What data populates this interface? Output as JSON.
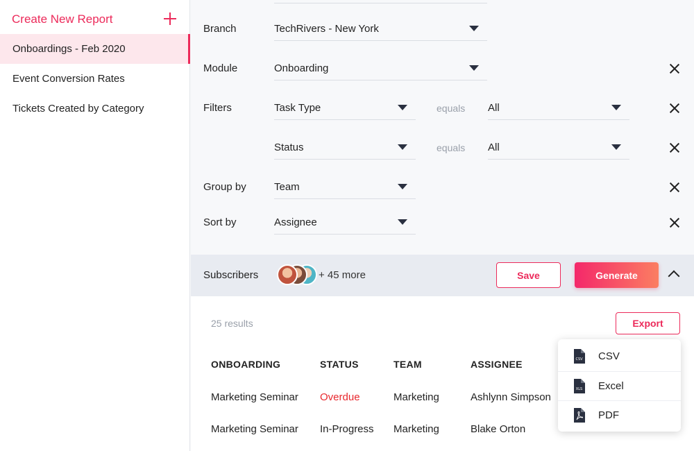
{
  "sidebar": {
    "create_label": "Create New Report",
    "items": [
      {
        "label": "Onboardings - Feb 2020",
        "active": true
      },
      {
        "label": "Event Conversion Rates",
        "active": false
      },
      {
        "label": "Tickets Created by Category",
        "active": false
      }
    ]
  },
  "form": {
    "branch": {
      "label": "Branch",
      "value": "TechRivers - New York"
    },
    "module": {
      "label": "Module",
      "value": "Onboarding"
    },
    "filters": {
      "label": "Filters",
      "rows": [
        {
          "field": "Task Type",
          "operator": "equals",
          "value": "All"
        },
        {
          "field": "Status",
          "operator": "equals",
          "value": "All"
        }
      ]
    },
    "group_by": {
      "label": "Group by",
      "value": "Team"
    },
    "sort_by": {
      "label": "Sort by",
      "value": "Assignee"
    }
  },
  "subscribers": {
    "label": "Subscribers",
    "more": "+ 45 more",
    "save_label": "Save",
    "generate_label": "Generate"
  },
  "results": {
    "count_text": "25 results",
    "export_label": "Export",
    "columns": [
      "ONBOARDING",
      "STATUS",
      "TEAM",
      "ASSIGNEE"
    ],
    "rows": [
      {
        "onboarding": "Marketing Seminar",
        "status": "Overdue",
        "team": "Marketing",
        "assignee": "Ashlynn Simpson"
      },
      {
        "onboarding": "Marketing Seminar",
        "status": "In-Progress",
        "team": "Marketing",
        "assignee": "Blake Orton"
      }
    ],
    "status_colors": {
      "Overdue": "#e8282e",
      "In-Progress": "#222222"
    }
  },
  "export_menu": {
    "items": [
      {
        "label": "CSV",
        "icon": "csv-file-icon",
        "badge": "CSV"
      },
      {
        "label": "Excel",
        "icon": "excel-file-icon",
        "badge": "XLS"
      },
      {
        "label": "PDF",
        "icon": "pdf-file-icon"
      }
    ]
  },
  "colors": {
    "accent": "#ec2a5a",
    "active_bg": "#fde7ec"
  }
}
